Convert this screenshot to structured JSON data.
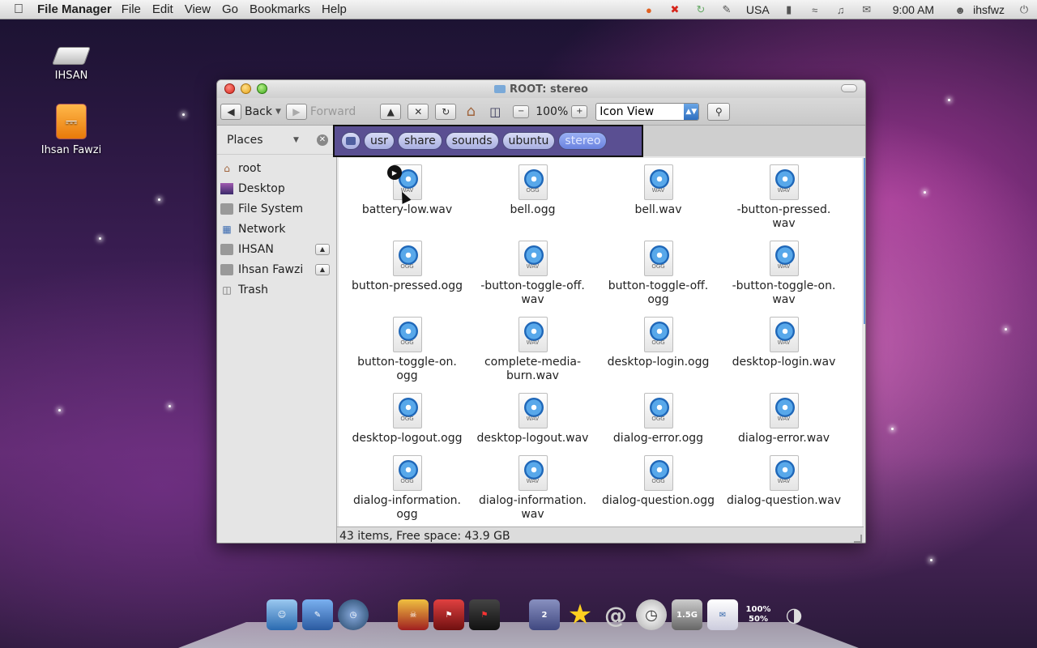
{
  "topbar": {
    "app_name": "File Manager",
    "menus": [
      "File",
      "Edit",
      "View",
      "Go",
      "Bookmarks",
      "Help"
    ],
    "keyboard_layout": "USA",
    "clock": "9:00 AM",
    "user": "ihsfwz"
  },
  "desktop": {
    "icons": [
      "IHSAN",
      "Ihsan Fawzi"
    ]
  },
  "window": {
    "title": "ROOT: stereo",
    "toolbar": {
      "back_label": "Back",
      "forward_label": "Forward",
      "zoom": "100%",
      "view_mode": "Icon View"
    },
    "sidebar": {
      "header": "Places",
      "items": [
        "root",
        "Desktop",
        "File System",
        "Network",
        "IHSAN",
        "Ihsan Fawzi",
        "Trash"
      ]
    },
    "path": [
      "usr",
      "share",
      "sounds",
      "ubuntu",
      "stereo"
    ],
    "files": [
      {
        "name": "battery-low.wav",
        "ext": "WAV"
      },
      {
        "name": "bell.ogg",
        "ext": "OGG"
      },
      {
        "name": "bell.wav",
        "ext": "WAV"
      },
      {
        "name": "-button-pressed.\nwav",
        "ext": "WAV"
      },
      {
        "name": "button-pressed.ogg",
        "ext": "OGG"
      },
      {
        "name": "-button-toggle-off.\nwav",
        "ext": "WAV"
      },
      {
        "name": "button-toggle-off.\nogg",
        "ext": "OGG"
      },
      {
        "name": "-button-toggle-on.\nwav",
        "ext": "WAV"
      },
      {
        "name": "button-toggle-on.\nogg",
        "ext": "OGG"
      },
      {
        "name": "complete-media-\nburn.wav",
        "ext": "WAV"
      },
      {
        "name": "desktop-login.ogg",
        "ext": "OGG"
      },
      {
        "name": "desktop-login.wav",
        "ext": "WAV"
      },
      {
        "name": "desktop-logout.ogg",
        "ext": "OGG"
      },
      {
        "name": "desktop-logout.wav",
        "ext": "WAV"
      },
      {
        "name": "dialog-error.ogg",
        "ext": "OGG"
      },
      {
        "name": "dialog-error.wav",
        "ext": "WAV"
      },
      {
        "name": "dialog-information.\nogg",
        "ext": "OGG"
      },
      {
        "name": "dialog-information.\nwav",
        "ext": "WAV"
      },
      {
        "name": "dialog-question.ogg",
        "ext": "OGG"
      },
      {
        "name": "dialog-question.wav",
        "ext": "WAV"
      }
    ],
    "status": "43 items, Free space: 43.9 GB"
  },
  "dock": {
    "disk_label": "1.5G",
    "battery_label": "100%\n50%",
    "workspace_label": "2"
  },
  "colors": {
    "pathbar_highlight": "#5a4f92",
    "accent_blue": "#2e6fc0"
  }
}
